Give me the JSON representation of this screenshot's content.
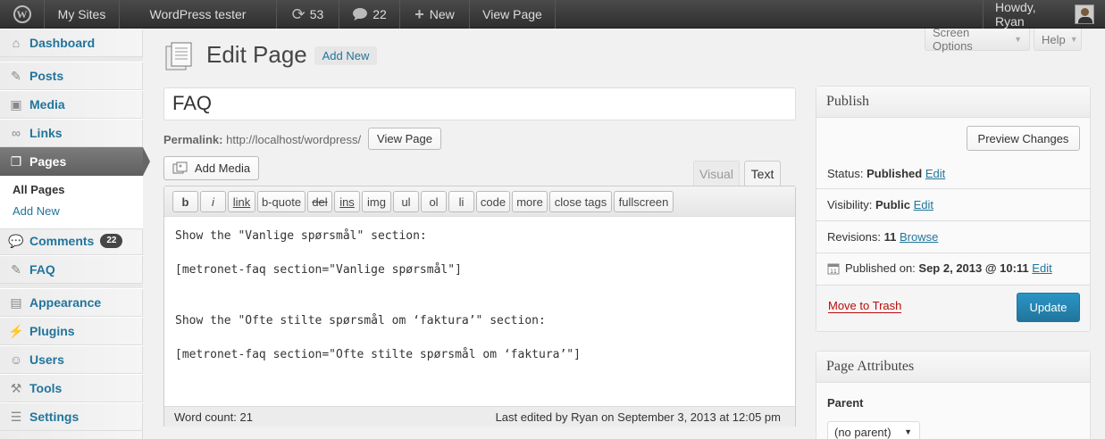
{
  "adminbar": {
    "my_sites": "My Sites",
    "site_name": "WordPress tester",
    "updates_count": "53",
    "comments_count": "22",
    "new_label": "New",
    "view_page": "View Page",
    "howdy": "Howdy, Ryan"
  },
  "sidebar": {
    "items": [
      {
        "label": "Dashboard",
        "icon": "dashboard-icon"
      },
      {
        "label": "Posts",
        "icon": "pushpin-icon"
      },
      {
        "label": "Media",
        "icon": "media-icon"
      },
      {
        "label": "Links",
        "icon": "link-icon"
      },
      {
        "label": "Pages",
        "icon": "pages-icon"
      },
      {
        "label": "Comments",
        "icon": "comment-icon",
        "badge": "22"
      },
      {
        "label": "FAQ",
        "icon": "pushpin-icon"
      },
      {
        "label": "Appearance",
        "icon": "appearance-icon"
      },
      {
        "label": "Plugins",
        "icon": "plugin-icon"
      },
      {
        "label": "Users",
        "icon": "users-icon"
      },
      {
        "label": "Tools",
        "icon": "tools-icon"
      },
      {
        "label": "Settings",
        "icon": "settings-icon"
      }
    ],
    "submenu": {
      "all_pages": "All Pages",
      "add_new": "Add New"
    }
  },
  "header": {
    "screen_options": "Screen Options",
    "help": "Help",
    "title": "Edit Page",
    "add_new": "Add New"
  },
  "editor": {
    "post_title": "FAQ",
    "permalink_label": "Permalink:",
    "permalink_url": "http://localhost/wordpress/",
    "view_page_button": "View Page",
    "add_media": "Add Media",
    "tab_visual": "Visual",
    "tab_text": "Text",
    "quicktags": [
      "b",
      "i",
      "link",
      "b-quote",
      "del",
      "ins",
      "img",
      "ul",
      "ol",
      "li",
      "code",
      "more",
      "close tags",
      "fullscreen"
    ],
    "content_lines": [
      "Show the \"Vanlige spørsmål\" section:",
      "",
      "[metronet-faq section=\"Vanlige spørsmål\"]",
      "",
      "",
      "Show the \"Ofte stilte spørsmål om ‘faktura’\" section:",
      "",
      "[metronet-faq section=\"Ofte stilte spørsmål om ‘faktura’\"]"
    ],
    "word_count": "Word count: 21",
    "last_edited": "Last edited by Ryan on September 3, 2013 at 12:05 pm"
  },
  "publish": {
    "heading": "Publish",
    "preview_changes": "Preview Changes",
    "status_label": "Status:",
    "status_value": "Published",
    "visibility_label": "Visibility:",
    "visibility_value": "Public",
    "revisions_label": "Revisions:",
    "revisions_value": "11",
    "browse": "Browse",
    "published_on_label": "Published on:",
    "published_on_value": "Sep 2, 2013 @ 10:11",
    "edit": "Edit",
    "move_to_trash": "Move to Trash",
    "update": "Update"
  },
  "page_attributes": {
    "heading": "Page Attributes",
    "parent_label": "Parent",
    "parent_value": "(no parent)"
  },
  "colors": {
    "link": "#21759b",
    "adminbar": "#333333",
    "update_button": "#21759b",
    "trash": "#bc0b0b"
  }
}
